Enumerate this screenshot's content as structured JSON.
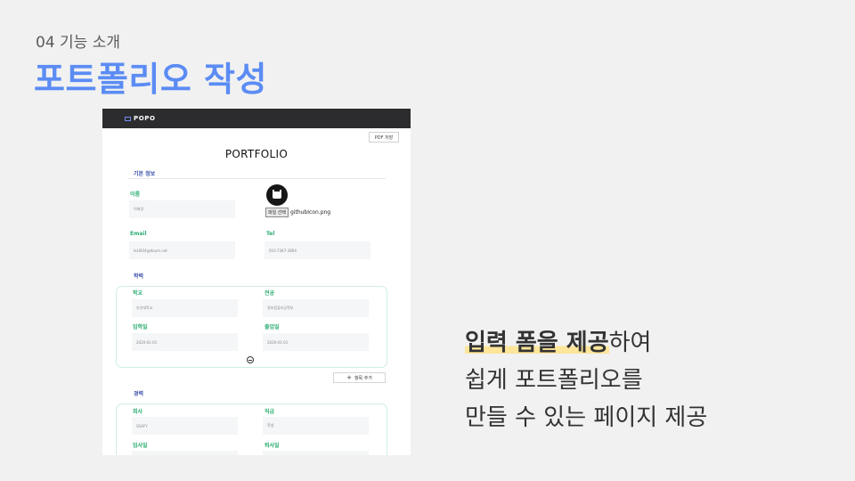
{
  "slide": {
    "subtitle": "04 기능 소개",
    "title": "포트폴리오 작성",
    "description": {
      "highlight": "입력 폼을 제공",
      "line1_rest": "하여",
      "line2": "쉽게 포트폴리오를",
      "line3": "만들 수 있는 페이지 제공"
    },
    "colors": {
      "title": "#5b8cf4",
      "highlight": "#fde59a",
      "section": "#3a4fa8",
      "label": "#2fae73"
    }
  },
  "app": {
    "brand": "POPO",
    "brand_icon": "book-icon",
    "pdf_button": "PDF 저장",
    "page_title": "PORTFOLIO",
    "basic": {
      "section": "기본 정보",
      "name_label": "이름",
      "name_value": "이태경",
      "email_label": "Email",
      "email_value": "leLI934@daum.net",
      "tel_label": "Tel",
      "tel_value": "010-7367-3894",
      "file_button": "파일 선택",
      "file_name": "githubIcon.png",
      "avatar_icon": "github-icon"
    },
    "education": {
      "section": "학력",
      "school_label": "학교",
      "school_value": "부산대학교",
      "major_label": "전공",
      "major_value": "정보컴퓨터공학부",
      "entry_label": "입학일",
      "entry_value": "2020-01-01",
      "grad_label": "졸업일",
      "grad_value": "2020-01-01",
      "add_button": "항목 추가"
    },
    "career": {
      "section": "경력",
      "company_label": "회사",
      "company_value": "SSAFY",
      "position_label": "직급",
      "position_value": "학생",
      "join_label": "입사일",
      "leave_label": "퇴사일"
    }
  }
}
